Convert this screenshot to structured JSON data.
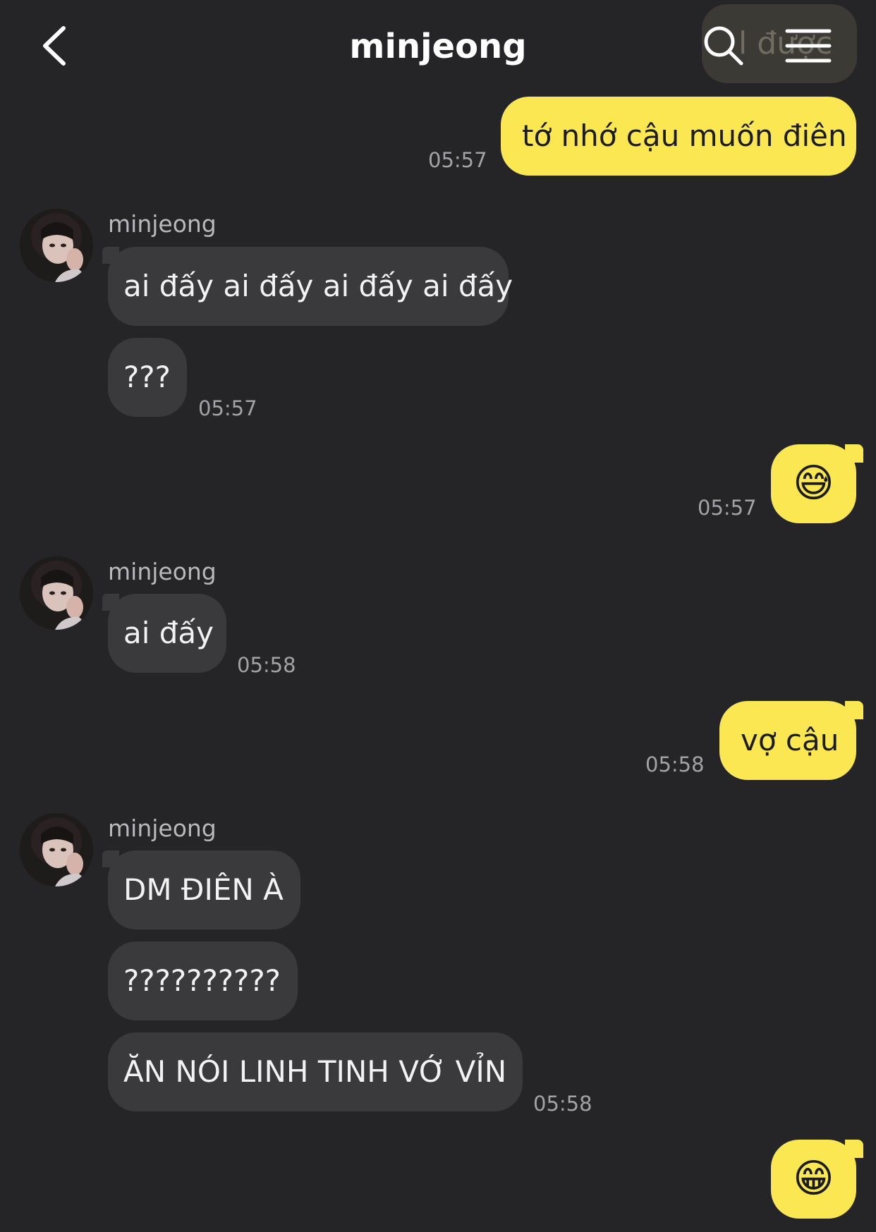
{
  "header": {
    "title": "minjeong",
    "peek_text": "l được"
  },
  "messages": [
    {
      "direction": "outgoing",
      "text": "tớ nhớ cậu muốn điên",
      "time": "05:57"
    },
    {
      "direction": "incoming",
      "sender": "minjeong",
      "texts": [
        "ai đấy ai đấy ai đấy ai đấy",
        "???"
      ],
      "time": "05:57"
    },
    {
      "direction": "outgoing",
      "emoji": "😅",
      "time": "05:57"
    },
    {
      "direction": "incoming",
      "sender": "minjeong",
      "texts": [
        "ai đấy"
      ],
      "time": "05:58"
    },
    {
      "direction": "outgoing",
      "text": "vợ cậu",
      "time": "05:58"
    },
    {
      "direction": "incoming",
      "sender": "minjeong",
      "texts": [
        "DM ĐIÊN À",
        "??????????",
        "ĂN NÓI LINH TINH VỚ VỈN"
      ],
      "time": "05:58"
    },
    {
      "direction": "outgoing",
      "emoji": "😁"
    }
  ],
  "colors": {
    "background": "#252528",
    "incoming_bubble": "#3a3a3d",
    "outgoing_bubble": "#fae751",
    "timestamp": "#a3a3a6"
  },
  "icons": [
    "chevron-left-icon",
    "search-icon",
    "hamburger-menu-icon"
  ]
}
